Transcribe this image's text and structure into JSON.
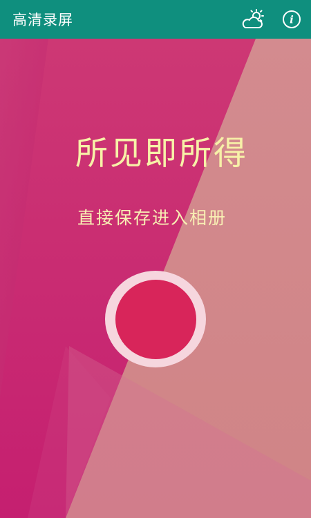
{
  "appbar": {
    "title": "高清录屏",
    "actions": [
      {
        "icon": "weather-icon"
      },
      {
        "icon": "info-icon",
        "glyph": "i"
      }
    ]
  },
  "main": {
    "headline": "所见即所得",
    "subline": "直接保存进入相册",
    "record_button": {
      "icon": "record-icon"
    }
  },
  "colors": {
    "appbar_bg": "#0f8f7e",
    "background_magenta": "#c8246f",
    "background_pink": "#d4878d",
    "headline_text": "#f7f1a8",
    "record_ring": "#f6d6de",
    "record_fill": "#d8255a"
  }
}
